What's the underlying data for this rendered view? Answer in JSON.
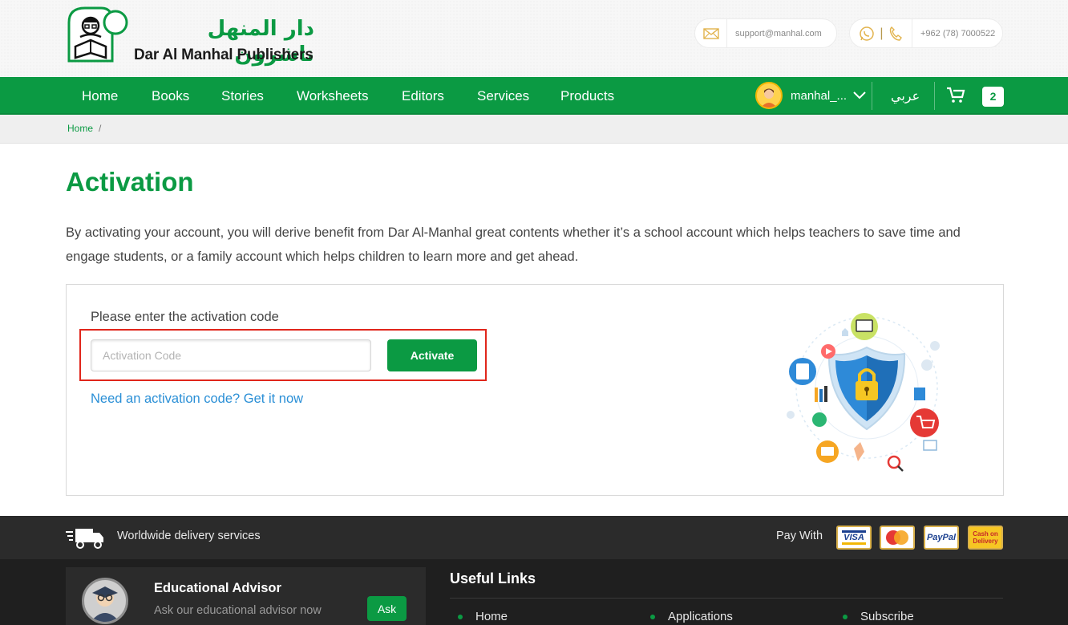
{
  "brand": {
    "name_ar": "دار المنهل ناشرون",
    "name_en": "Dar Al Manhal Publishers"
  },
  "contact": {
    "email": "support@manhal.com",
    "phone": "+962 (78) 7000522"
  },
  "nav": {
    "items": [
      "Home",
      "Books",
      "Stories",
      "Worksheets",
      "Editors",
      "Services",
      "Products"
    ],
    "username": "manhal_...",
    "language": "عربي",
    "cart_count": "2"
  },
  "breadcrumb": {
    "home": "Home",
    "separator": "/"
  },
  "page": {
    "title": "Activation",
    "description": "By activating your account, you will derive benefit from Dar Al-Manhal great contents whether it’s a school account which helps teachers to save time and engage students, or a family account which helps children to learn more and get ahead."
  },
  "activation": {
    "prompt": "Please enter the activation code",
    "input_placeholder": "Activation Code",
    "input_value": "",
    "button_label": "Activate",
    "link_text": "Need an activation code? Get it now"
  },
  "footer": {
    "delivery_text": "Worldwide delivery services",
    "pay_with": "Pay With",
    "payment_methods": [
      "VISA",
      "MasterCard",
      "PayPal",
      "Cash on Delivery"
    ],
    "advisor_title": "Educational Advisor",
    "advisor_subtitle": "Ask our educational advisor now",
    "ask_label": "Ask",
    "useful_links_title": "Useful Links",
    "useful_links": [
      "Home",
      "Applications",
      "Subscribe"
    ]
  },
  "colors": {
    "brand_green": "#0b9a43",
    "highlight_red": "#e0261b",
    "link_blue": "#2a8fd6"
  }
}
